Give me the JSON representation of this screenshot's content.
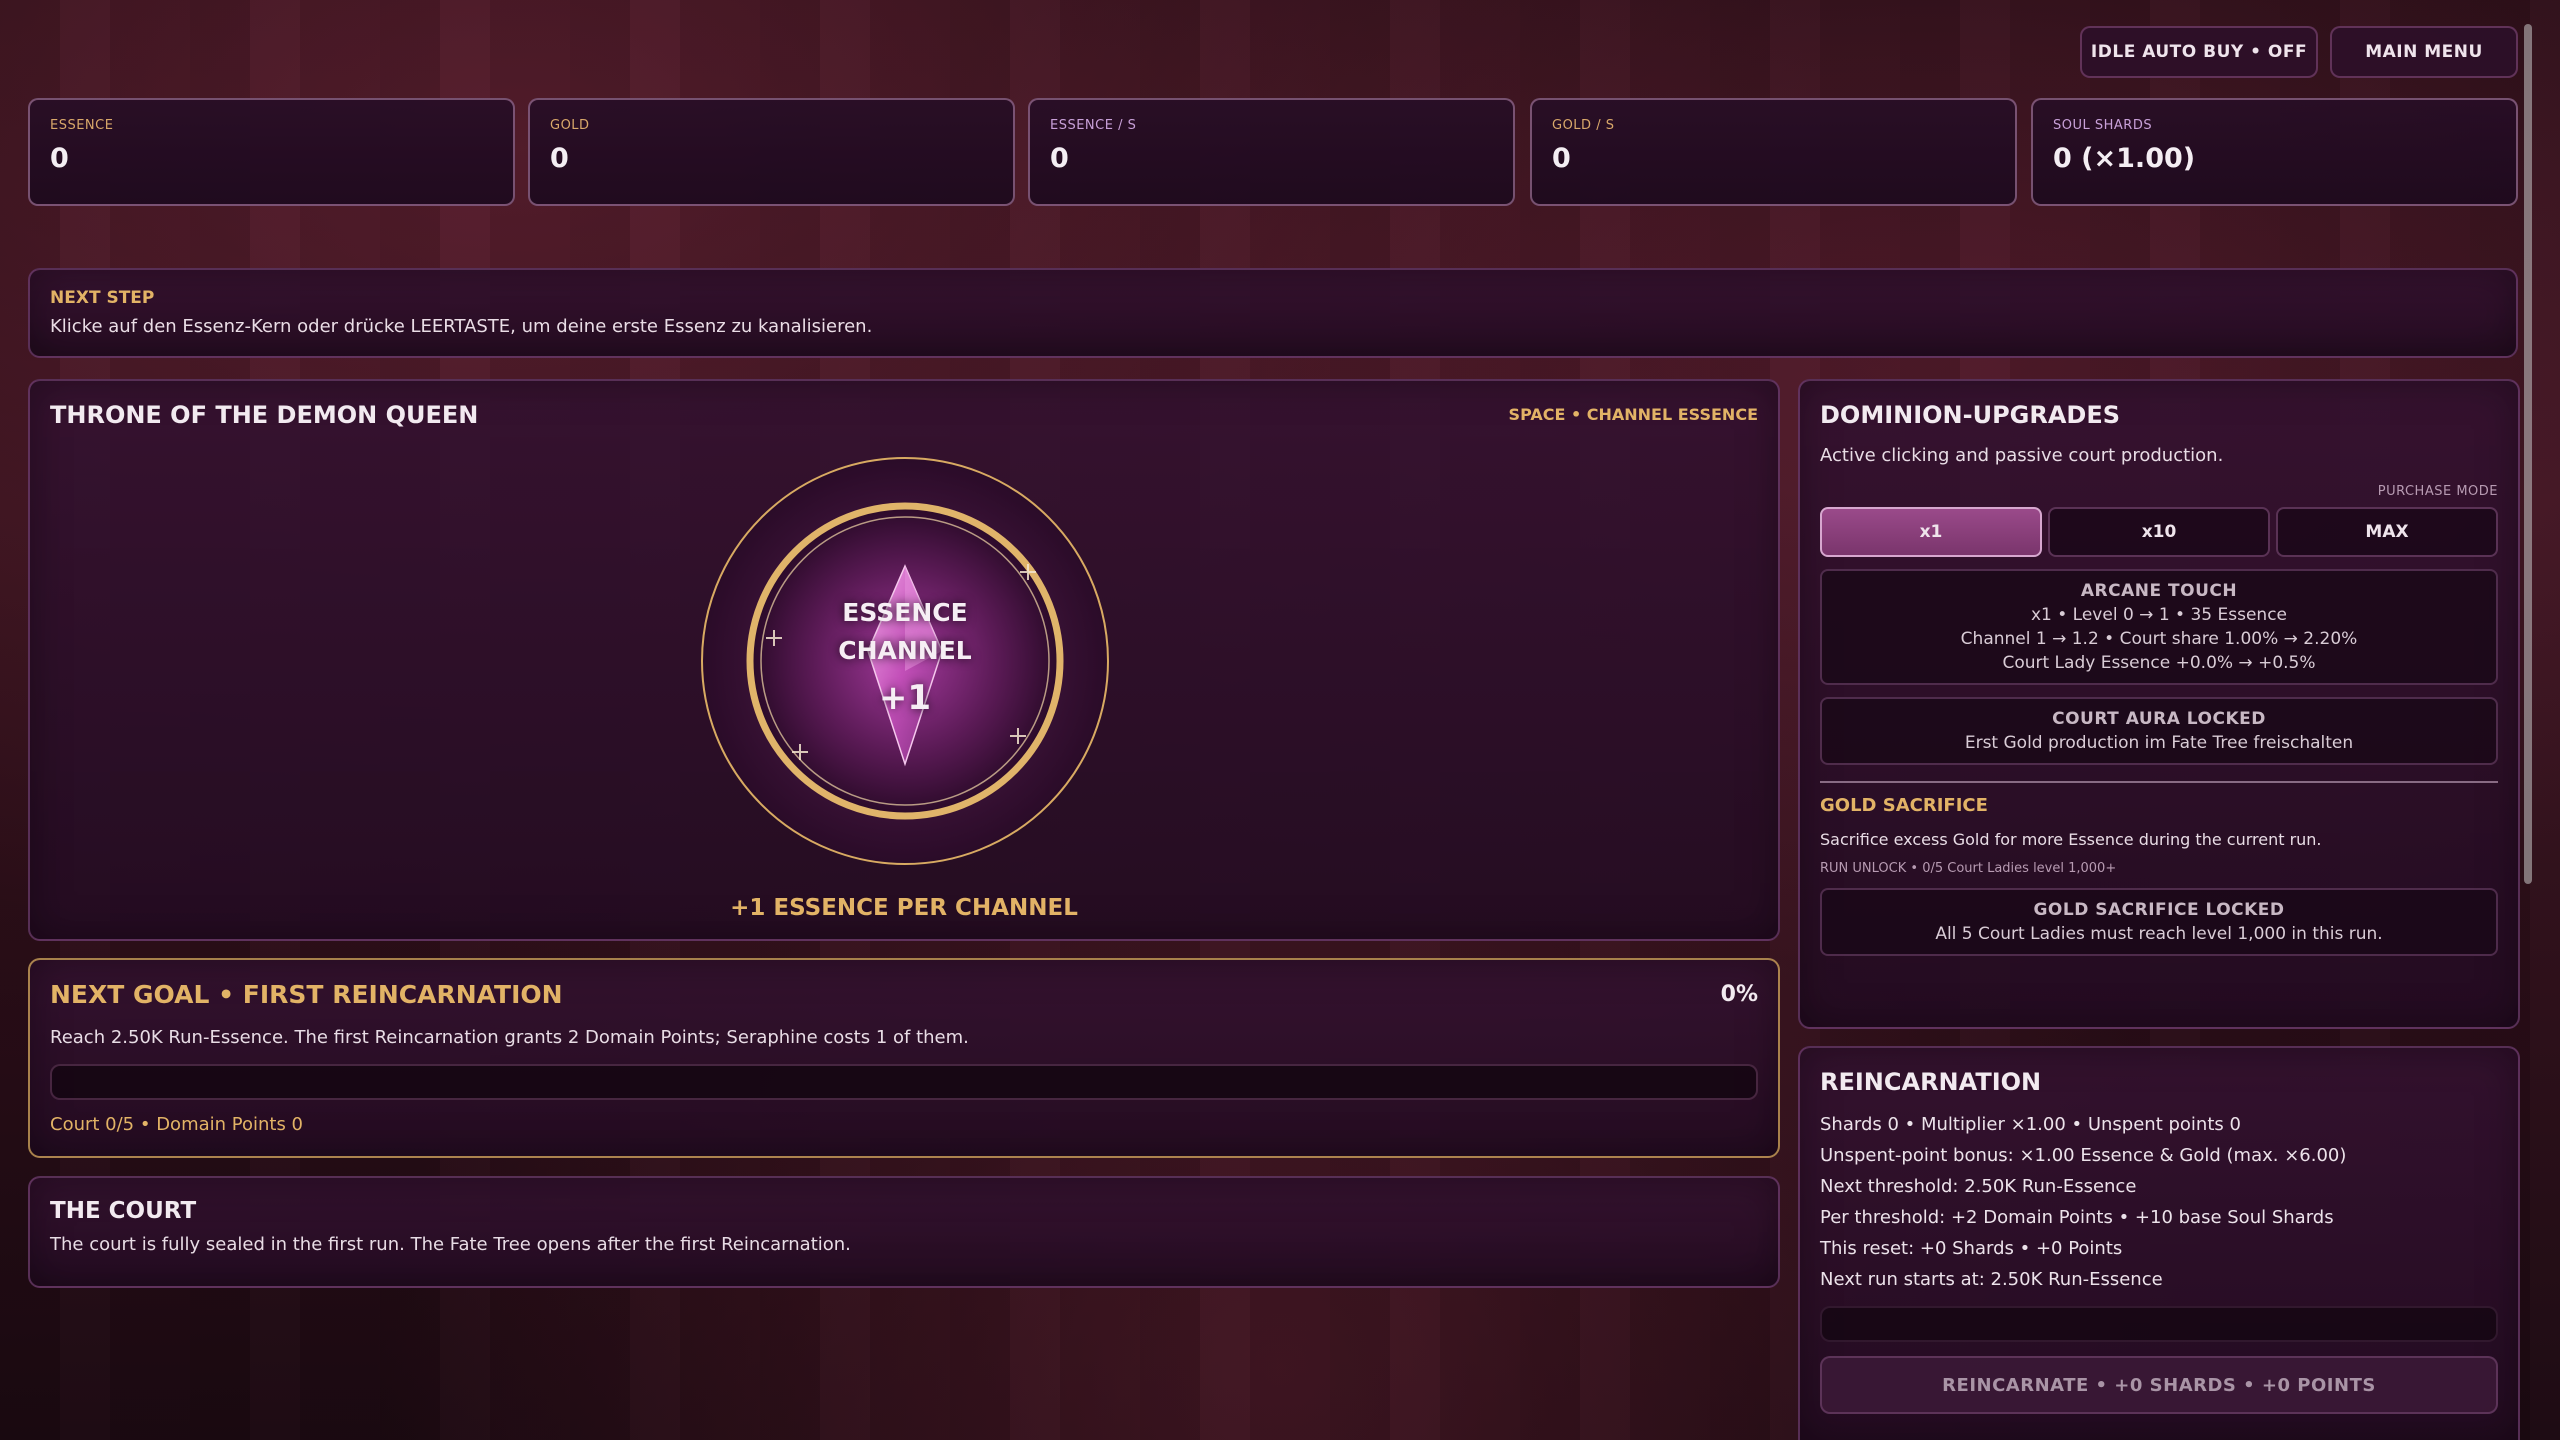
{
  "header": {
    "idle_auto_buy": "IDLE AUTO BUY • OFF",
    "main_menu": "MAIN MENU"
  },
  "stats": [
    {
      "label": "ESSENCE",
      "value": "0"
    },
    {
      "label": "GOLD",
      "value": "0"
    },
    {
      "label": "ESSENCE / S",
      "value": "0"
    },
    {
      "label": "GOLD / S",
      "value": "0"
    },
    {
      "label": "SOUL SHARDS",
      "value": "0  (×1.00)"
    }
  ],
  "next_step": {
    "title": "NEXT STEP",
    "text": "Klicke auf den Essenz-Kern oder drücke LEERTASTE, um deine erste Essenz zu kanalisieren."
  },
  "throne": {
    "title": "THRONE OF THE DEMON QUEEN",
    "hotkey": "SPACE • CHANNEL ESSENCE",
    "orb_line1": "ESSENCE",
    "orb_line2": "CHANNEL",
    "orb_gain": "+1",
    "per_channel": "+1 ESSENCE PER CHANNEL"
  },
  "goal": {
    "title": "NEXT GOAL • FIRST REINCARNATION",
    "percent": "0%",
    "progress": 0,
    "text": "Reach 2.50K Run-Essence. The first Reincarnation grants 2 Domain Points; Seraphine costs 1 of them.",
    "footer": "Court 0/5 • Domain Points 0"
  },
  "court": {
    "title": "THE COURT",
    "text": "The court is fully sealed in the first run. The Fate Tree opens after the first Reincarnation."
  },
  "dominion": {
    "title": "DOMINION-UPGRADES",
    "subtitle": "Active clicking and passive court production.",
    "purchase_mode_label": "PURCHASE MODE",
    "modes": [
      "x1",
      "x10",
      "MAX"
    ],
    "upgrades": [
      {
        "name": "ARCANE TOUCH",
        "lines": [
          "x1 • Level 0 → 1 • 35 Essence",
          "Channel 1 → 1.2 • Court share 1.00% → 2.20%",
          "Court Lady Essence +0.0% → +0.5%"
        ]
      },
      {
        "name": "COURT AURA LOCKED",
        "lines": [
          "Erst Gold production im Fate Tree freischalten"
        ]
      }
    ],
    "gold_sacrifice": {
      "title": "GOLD SACRIFICE",
      "text": "Sacrifice excess Gold for more Essence during the current run.",
      "unlock": "RUN UNLOCK • 0/5 Court Ladies level 1,000+",
      "locked_name": "GOLD SACRIFICE LOCKED",
      "locked_text": "All 5 Court Ladies must reach level 1,000 in this run."
    }
  },
  "reincarnation": {
    "title": "REINCARNATION",
    "lines": [
      "Shards 0 • Multiplier ×1.00 • Unspent points 0",
      "Unspent-point bonus: ×1.00 Essence & Gold (max. ×6.00)",
      "Next threshold: 2.50K Run-Essence",
      "Per threshold: +2 Domain Points • +10 base Soul Shards",
      "This reset: +0 Shards • +0 Points",
      "Next run starts at: 2.50K Run-Essence"
    ],
    "button": "REINCARNATE • +0 SHARDS • +0 POINTS"
  }
}
